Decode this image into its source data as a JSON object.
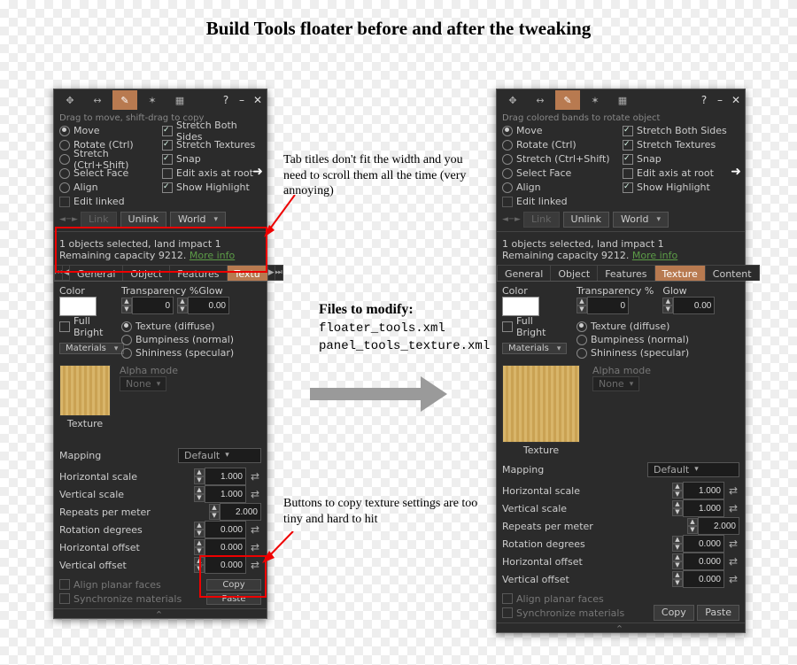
{
  "page_title": "Build Tools floater before and after the tweaking",
  "annotations": {
    "tabs": "Tab titles don't fit the width and you need to scroll them all the time (very annoying)",
    "files_title": "Files to modify:",
    "files": [
      "floater_tools.xml",
      "panel_tools_texture.xml"
    ],
    "copy": "Buttons to copy texture settings are too tiny and hard to hit"
  },
  "floater": {
    "hint_before": "Drag to move, shift-drag to copy",
    "hint_after": "Drag colored bands to rotate object",
    "left_opts": [
      {
        "kind": "radio",
        "label": "Move",
        "on": true
      },
      {
        "kind": "radio",
        "label": "Rotate (Ctrl)"
      },
      {
        "kind": "radio",
        "label": "Stretch (Ctrl+Shift)"
      },
      {
        "kind": "radio",
        "label": "Select Face"
      },
      {
        "kind": "radio",
        "label": "Align"
      },
      {
        "kind": "check",
        "label": "Edit linked",
        "dim": true
      }
    ],
    "right_opts": [
      {
        "kind": "check",
        "label": "Stretch Both Sides",
        "on": true
      },
      {
        "kind": "check",
        "label": "Stretch Textures",
        "on": true
      },
      {
        "kind": "check",
        "label": "Snap",
        "on": true
      },
      {
        "kind": "check",
        "label": "Edit axis at root"
      },
      {
        "kind": "check",
        "label": "Show Highlight",
        "on": true
      }
    ],
    "link": "Link",
    "unlink": "Unlink",
    "world": "World",
    "sel_line1": "1 objects selected, land impact 1",
    "sel_line2_a": "Remaining capacity 9212. ",
    "sel_more": "More info",
    "tabs_before": [
      "General",
      "Object",
      "Features",
      "Textu"
    ],
    "tabs_after": [
      "General",
      "Object",
      "Features",
      "Texture",
      "Content"
    ],
    "color": "Color",
    "transp": "Transparency %",
    "glow": "Glow",
    "transp_val": "0",
    "glow_val": "0.00",
    "fullbright": "Full Bright",
    "materials": "Materials",
    "tex_radios": [
      {
        "label": "Texture (diffuse)",
        "on": true
      },
      {
        "label": "Bumpiness (normal)"
      },
      {
        "label": "Shininess (specular)"
      }
    ],
    "alpha_mode": "Alpha mode",
    "alpha_none": "None",
    "texture": "Texture",
    "mapping": "Mapping",
    "mapping_val": "Default",
    "params": [
      {
        "l": "Horizontal scale",
        "v": "1.000",
        "sync": true
      },
      {
        "l": "Vertical scale",
        "v": "1.000",
        "sync": true
      },
      {
        "l": "Repeats per meter",
        "v": "2.000"
      },
      {
        "l": "Rotation degrees",
        "v": "0.000",
        "sync": true
      },
      {
        "l": "Horizontal offset",
        "v": "0.000",
        "sync": true
      },
      {
        "l": "Vertical offset",
        "v": "0.000",
        "sync": true
      }
    ],
    "align_planar": "Align planar faces",
    "sync_materials": "Synchronize materials",
    "copy": "Copy",
    "paste": "Paste"
  }
}
